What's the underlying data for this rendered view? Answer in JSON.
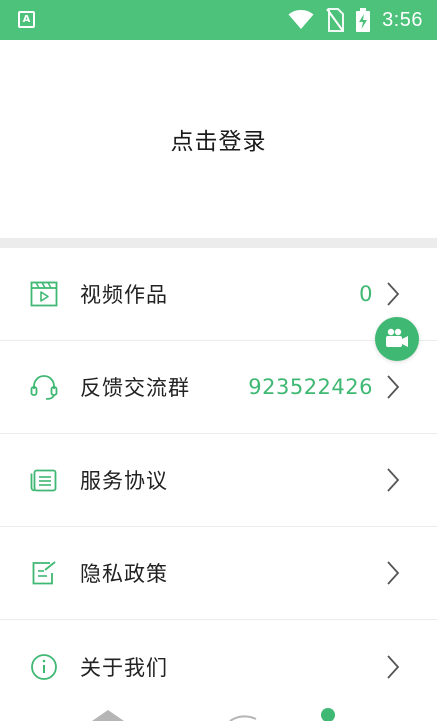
{
  "status_bar": {
    "app_badge": "A",
    "time": "3:56",
    "icons": [
      "app-notification-icon",
      "wifi-icon",
      "no-sim-icon",
      "battery-charging-icon"
    ],
    "color": "#4cc27a"
  },
  "profile": {
    "login_prompt": "点击登录"
  },
  "menu": {
    "accent_color": "#3fb873",
    "items": [
      {
        "label": "视频作品",
        "value": "0",
        "icon": "video-works-icon"
      },
      {
        "label": "反馈交流群",
        "value": "923522426",
        "icon": "headset-icon"
      },
      {
        "label": "服务协议",
        "value": "",
        "icon": "agreement-icon"
      },
      {
        "label": "隐私政策",
        "value": "",
        "icon": "privacy-policy-icon"
      },
      {
        "label": "关于我们",
        "value": "",
        "icon": "about-icon"
      }
    ]
  },
  "fab": {
    "icon": "video-camera-icon"
  },
  "bottom_nav": {
    "icons": [
      "home-icon",
      "discover-icon",
      "profile-icon"
    ]
  }
}
